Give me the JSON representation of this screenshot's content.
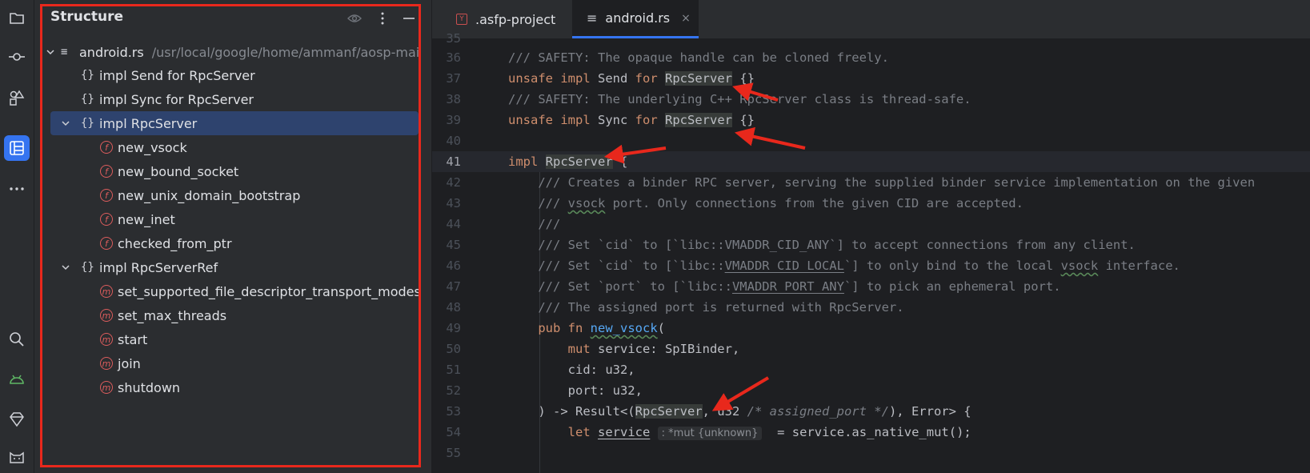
{
  "activity_bar": {
    "icons": [
      "folder-icon",
      "commit-icon",
      "shapes-icon",
      "structure-icon",
      "more-icon",
      "search-icon",
      "android-icon",
      "gem-icon",
      "cat-icon"
    ]
  },
  "structure_panel": {
    "title": "Structure",
    "file": {
      "name": "android.rs",
      "path": "/usr/local/google/home/ammanf/aosp-main-w"
    },
    "items": [
      {
        "label": "impl Send for RpcServer",
        "kind": "impl"
      },
      {
        "label": "impl Sync for RpcServer",
        "kind": "impl"
      },
      {
        "label": "impl RpcServer",
        "kind": "impl",
        "selected": true
      },
      {
        "label": "new_vsock",
        "kind": "function",
        "badge": "f"
      },
      {
        "label": "new_bound_socket",
        "kind": "function",
        "badge": "f"
      },
      {
        "label": "new_unix_domain_bootstrap",
        "kind": "function",
        "badge": "f"
      },
      {
        "label": "new_inet",
        "kind": "function",
        "badge": "f"
      },
      {
        "label": "checked_from_ptr",
        "kind": "function",
        "badge": "f"
      },
      {
        "label": "impl RpcServerRef",
        "kind": "impl"
      },
      {
        "label": "set_supported_file_descriptor_transport_modes",
        "kind": "method",
        "badge": "m"
      },
      {
        "label": "set_max_threads",
        "kind": "method",
        "badge": "m"
      },
      {
        "label": "start",
        "kind": "method",
        "badge": "m"
      },
      {
        "label": "join",
        "kind": "method",
        "badge": "m"
      },
      {
        "label": "shutdown",
        "kind": "method",
        "badge": "m"
      }
    ],
    "impl_icon": "{}"
  },
  "tabs": [
    {
      "label": ".asfp-project",
      "icon": "Y"
    },
    {
      "label": "android.rs",
      "active": true,
      "close": "×"
    }
  ],
  "code": {
    "lines": [
      "35",
      "36",
      "37",
      "38",
      "39",
      "40",
      "41",
      "42",
      "43",
      "44",
      "45",
      "46",
      "47",
      "48",
      "49",
      "50",
      "51",
      "52",
      "53",
      "54",
      "55"
    ],
    "current_line": "41",
    "inlay_hint": ": *mut {unknown}"
  },
  "colors": {
    "highlight_frame": "#e8281c",
    "arrow": "#e8281c",
    "accent": "#3574f0"
  }
}
